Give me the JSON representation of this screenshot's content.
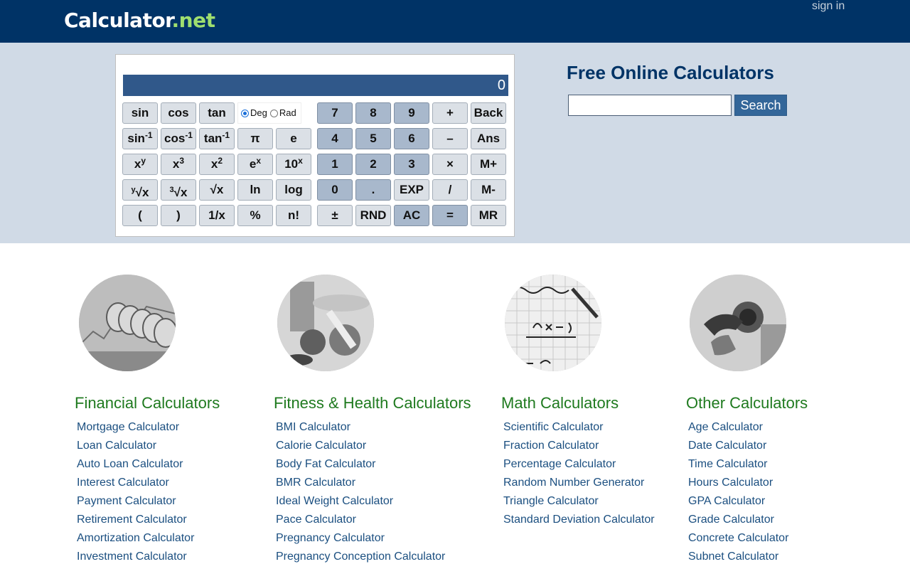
{
  "header": {
    "logo_main": "Calculator",
    "logo_dot": ".",
    "logo_net": "net",
    "sign_in": "sign in"
  },
  "calculator": {
    "display": "0",
    "angle_modes": [
      "Deg",
      "Rad"
    ],
    "angle_selected": "Deg",
    "sci_keys": [
      [
        "sin",
        "cos",
        "tan"
      ],
      [
        "sin-1",
        "cos-1",
        "tan-1",
        "π",
        "e"
      ],
      [
        "xy",
        "x3",
        "x2",
        "ex",
        "10x"
      ],
      [
        "y√x",
        "3√x",
        "√x",
        "ln",
        "log"
      ],
      [
        "(",
        ")",
        "1/x",
        "%",
        "n!"
      ]
    ],
    "basic_keys": [
      [
        "7",
        "8",
        "9",
        "+",
        "Back"
      ],
      [
        "4",
        "5",
        "6",
        "–",
        "Ans"
      ],
      [
        "1",
        "2",
        "3",
        "×",
        "M+"
      ],
      [
        "0",
        ".",
        "EXP",
        "/",
        "M-"
      ],
      [
        "±",
        "RND",
        "AC",
        "=",
        "MR"
      ]
    ]
  },
  "hero": {
    "title": "Free Online Calculators",
    "search_value": "",
    "search_button": "Search"
  },
  "categories": [
    {
      "title": "Financial Calculators",
      "image": "coins-on-financial-chart",
      "links": [
        "Mortgage Calculator",
        "Loan Calculator",
        "Auto Loan Calculator",
        "Interest Calculator",
        "Payment Calculator",
        "Retirement Calculator",
        "Amortization Calculator",
        "Investment Calculator"
      ]
    },
    {
      "title": "Fitness & Health Calculators",
      "image": "vegetables-and-measuring-tape",
      "links": [
        "BMI Calculator",
        "Calorie Calculator",
        "Body Fat Calculator",
        "BMR Calculator",
        "Ideal Weight Calculator",
        "Pace Calculator",
        "Pregnancy Calculator",
        "Pregnancy Conception Calculator"
      ]
    },
    {
      "title": "Math Calculators",
      "image": "math-formula-on-grid-paper",
      "links": [
        "Scientific Calculator",
        "Fraction Calculator",
        "Percentage Calculator",
        "Random Number Generator",
        "Triangle Calculator",
        "Standard Deviation Calculator"
      ]
    },
    {
      "title": "Other Calculators",
      "image": "fuel-pump-nozzle",
      "links": [
        "Age Calculator",
        "Date Calculator",
        "Time Calculator",
        "Hours Calculator",
        "GPA Calculator",
        "Grade Calculator",
        "Concrete Calculator",
        "Subnet Calculator"
      ]
    }
  ],
  "colors": {
    "header_bg": "#003366",
    "hero_bg": "#d0dae6",
    "display_bg": "#30588a",
    "category_title": "#1f7a1f",
    "link": "#1b4f80"
  }
}
